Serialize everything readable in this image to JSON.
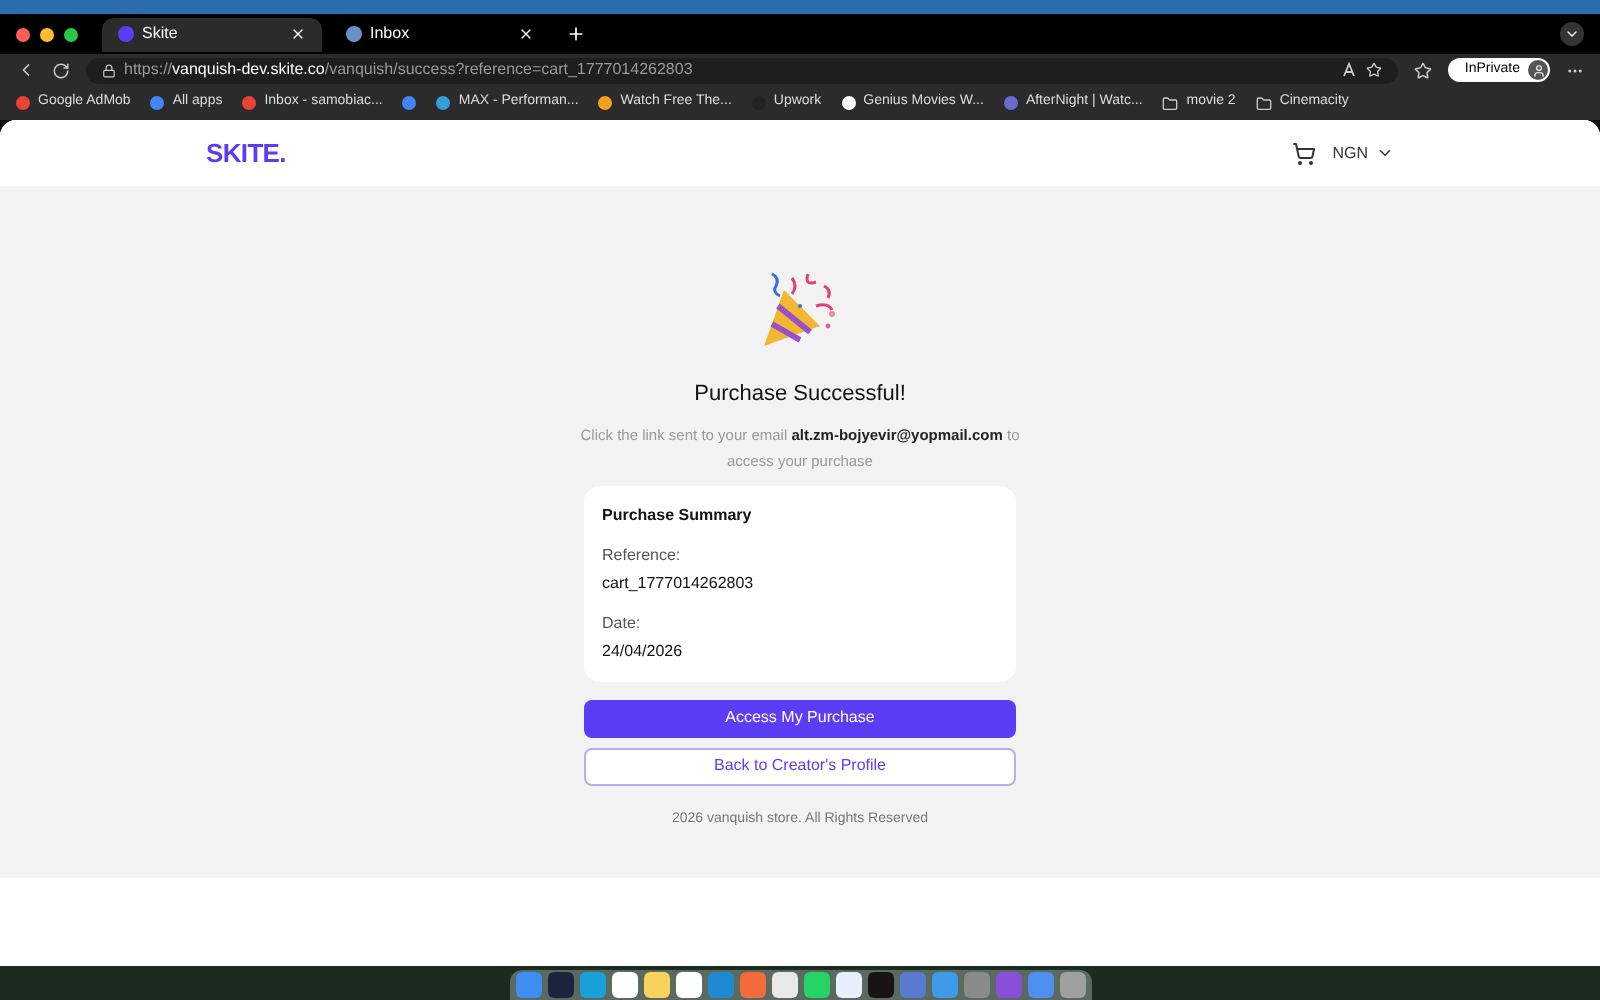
{
  "tabs": [
    {
      "label": "Skite",
      "selected": true
    },
    {
      "label": "Inbox",
      "selected": false
    }
  ],
  "address_bar": {
    "scheme": "https://",
    "host": "vanquish-dev.skite.co",
    "path": "/vanquish/success?reference=cart_1777014262803",
    "profile": "InPrivate"
  },
  "bookmarks": [
    {
      "label": "Google AdMob",
      "kind": "site",
      "color": "#ea4335"
    },
    {
      "label": "All apps",
      "kind": "site",
      "color": "#4285f4"
    },
    {
      "label": "Inbox - samobiac...",
      "kind": "site",
      "color": "#ea4335"
    },
    {
      "kind": "site",
      "color": "#4285f4"
    },
    {
      "label": "MAX - Performan...",
      "kind": "site",
      "color": "#34a0d8"
    },
    {
      "label": "Watch Free The...",
      "kind": "site",
      "color": "#f0a020"
    },
    {
      "label": "Upwork",
      "kind": "site",
      "color": "#222222"
    },
    {
      "label": "Genius Movies W...",
      "kind": "site",
      "color": "#ffffff"
    },
    {
      "label": "AfterNight | Watc...",
      "kind": "site",
      "color": "#6a6ad0"
    },
    {
      "label": "movie 2",
      "kind": "folder",
      "color": "#cccccc"
    },
    {
      "label": "Cinemacity",
      "kind": "folder",
      "color": "#cccccc"
    }
  ],
  "site_header": {
    "logo": "SKITE.",
    "currency": "NGN"
  },
  "success": {
    "title": "Purchase Successful!",
    "message": "Click the link sent to your email **alt.zm-bojyevir@yopmail.com** to access your purchase"
  },
  "summary": {
    "title": "Purchase Summary",
    "fields": [
      {
        "label": "Reference:",
        "value": "cart_1777014262803"
      },
      {
        "label": "Date:",
        "value": "24/04/2026"
      }
    ]
  },
  "buttons": [
    {
      "label": "Access My Purchase",
      "kind": "primary"
    },
    {
      "label": "Back to Creator's Profile",
      "kind": "outline"
    }
  ],
  "footer": "2026 vanquish store. All Rights Reserved",
  "dock": [
    {
      "color": "#3d8ef0"
    },
    {
      "color": "#1c2540"
    },
    {
      "color": "#1aa0d8"
    },
    {
      "color": "#ffffff"
    },
    {
      "color": "#f7d25c"
    },
    {
      "color": "#ffffff"
    },
    {
      "color": "#1f8ad2"
    },
    {
      "color": "#f26b3a"
    },
    {
      "color": "#e8e8e8"
    },
    {
      "color": "#25d366"
    },
    {
      "color": "#e8f0ff"
    },
    {
      "color": "#191414"
    },
    {
      "color": "#5a7bd0"
    },
    {
      "color": "#3d9be9"
    },
    {
      "color": "#8a8a8a"
    },
    {
      "color": "#8a4fd8"
    },
    {
      "color": "#4f8ff0"
    },
    {
      "color": "#a0a0a0"
    }
  ]
}
